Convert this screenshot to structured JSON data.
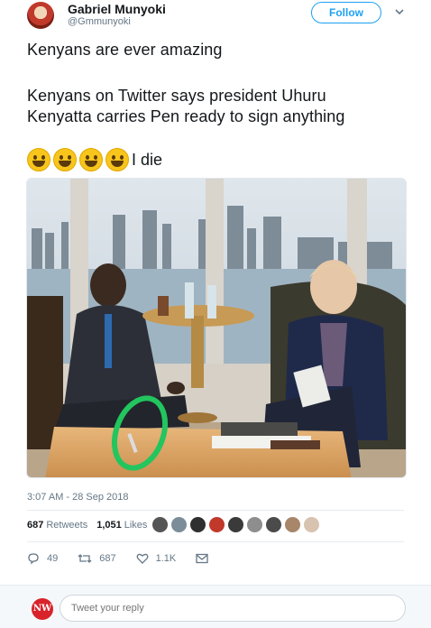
{
  "author": {
    "name": "Gabriel Munyoki",
    "handle": "@Gmmunyoki"
  },
  "follow_label": "Follow",
  "tweet": {
    "line1": "Kenyans are ever amazing",
    "line2": "Kenyans on Twitter says president Uhuru",
    "line3": "Kenyatta carries Pen ready to sign anything",
    "emoji_count": 4,
    "emoji_tail": "I die"
  },
  "timestamp": "3:07 AM - 28 Sep 2018",
  "stats": {
    "retweets_count": "687",
    "retweets_label": "Retweets",
    "likes_count": "1,051",
    "likes_label": "Likes"
  },
  "actions": {
    "replies": "49",
    "retweets": "687",
    "likes": "1.1K"
  },
  "reply": {
    "placeholder": "Tweet your reply",
    "avatar_text": "NW"
  },
  "colors": {
    "accent": "#1da1f2",
    "highlight_circle": "#22c55e"
  }
}
